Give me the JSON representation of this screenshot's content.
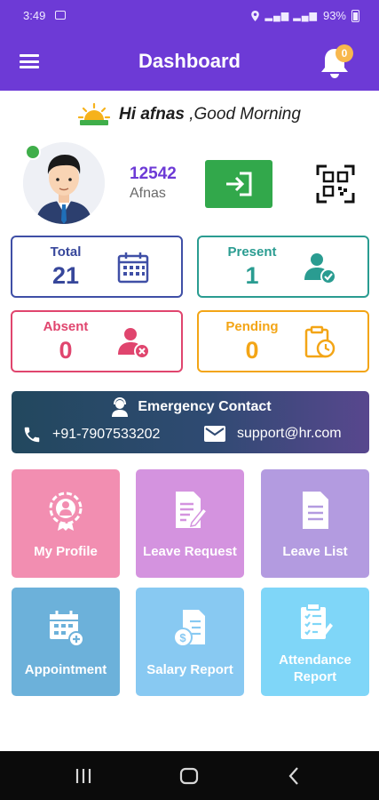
{
  "status_bar": {
    "time": "3:49",
    "battery": "93%"
  },
  "app_bar": {
    "title": "Dashboard",
    "notification_count": "0"
  },
  "greeting": {
    "prefix": "Hi",
    "name": "afnas",
    "suffix": ",Good Morning"
  },
  "profile": {
    "employee_id": "12542",
    "employee_name": "Afnas",
    "online": true
  },
  "stats": {
    "total": {
      "label": "Total",
      "value": "21"
    },
    "present": {
      "label": "Present",
      "value": "1"
    },
    "absent": {
      "label": "Absent",
      "value": "0"
    },
    "pending": {
      "label": "Pending",
      "value": "0"
    }
  },
  "emergency": {
    "title": "Emergency Contact",
    "phone": "+91-7907533202",
    "email": "support@hr.com"
  },
  "tiles": {
    "my_profile": "My Profile",
    "leave_request": "Leave Request",
    "leave_list": "Leave List",
    "appointment": "Appointment",
    "salary_report": "Salary Report",
    "attendance_report": "Attendance Report"
  },
  "icons": {
    "menu": "hamburger-menu-icon",
    "bell": "bell-icon",
    "sun": "sunrise-icon",
    "check_in": "login-arrow-icon",
    "qr": "qr-scan-icon",
    "calendar": "calendar-icon",
    "present": "user-check-icon",
    "absent": "user-remove-icon",
    "pending": "clipboard-clock-icon",
    "phone": "phone-icon",
    "mail": "mail-icon"
  },
  "colors": {
    "primary": "#6d3ad6",
    "total": "#3f4fa6",
    "present": "#2a9c91",
    "absent": "#e0456e",
    "pending": "#f3a516",
    "check_in": "#32a84b"
  }
}
